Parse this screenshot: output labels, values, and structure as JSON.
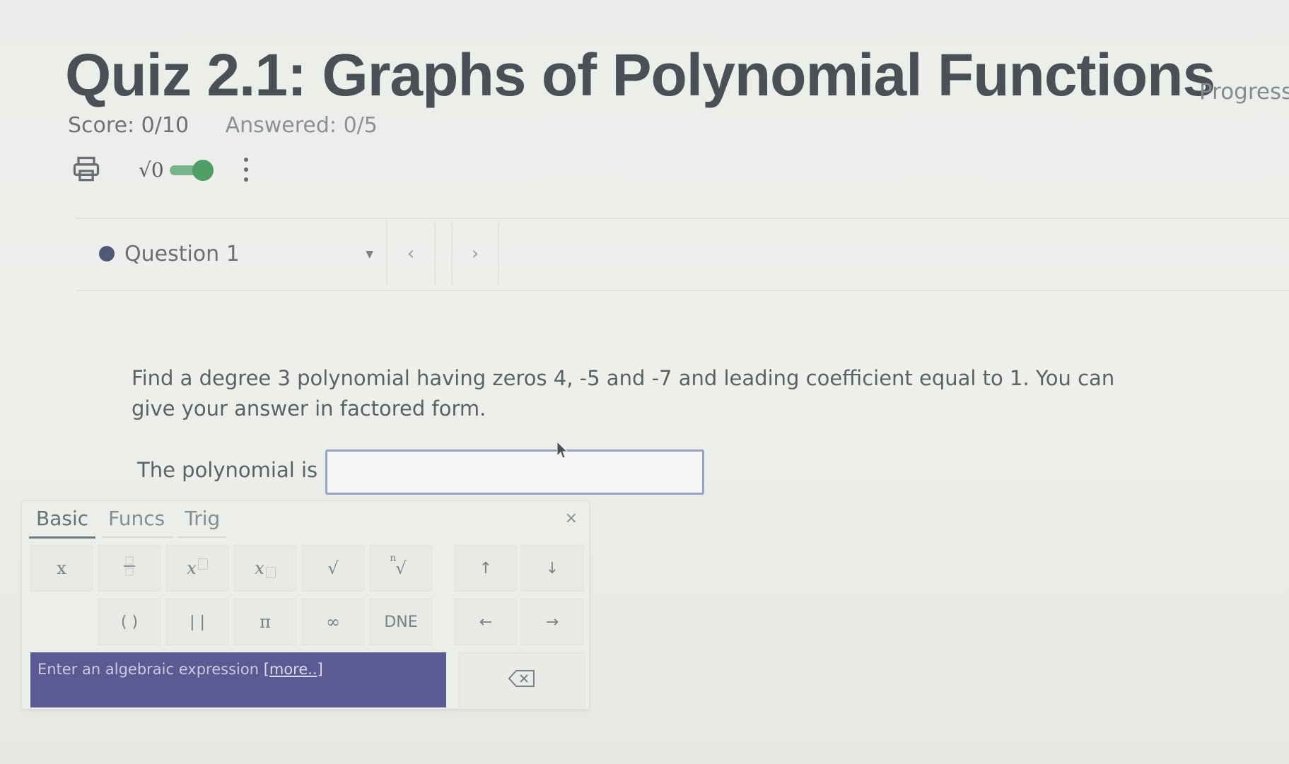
{
  "quiz": {
    "title": "Quiz 2.1: Graphs of Polynomial Functions",
    "progress_label": "Progress",
    "score": "Score: 0/10",
    "answered": "Answered: 0/5"
  },
  "toolbar": {
    "math_label": "√0",
    "math_toggle_on": true
  },
  "question_nav": {
    "current": "Question 1",
    "prev_symbol": "‹",
    "next_symbol": "›"
  },
  "question": {
    "text": "Find a degree 3 polynomial having zeros 4, -5 and -7 and leading coefficient equal to 1. You can give your answer in factored form.",
    "answer_label": "The polynomial is",
    "answer_value": ""
  },
  "keypad": {
    "tabs": [
      "Basic",
      "Funcs",
      "Trig"
    ],
    "close_symbol": "×",
    "row1": [
      "x",
      "",
      "",
      "",
      "√",
      "",
      "↑",
      "↓"
    ],
    "row2": [
      "( )",
      "| |",
      "π",
      "∞",
      "DNE",
      "←",
      "→"
    ],
    "banner_text": "Enter an algebraic expression ",
    "banner_link": "[more..]"
  },
  "colors": {
    "accent": "#5b5a93",
    "toggle": "#4f9e66",
    "question_dot": "#4e5975",
    "input_border": "#97a2c4"
  }
}
